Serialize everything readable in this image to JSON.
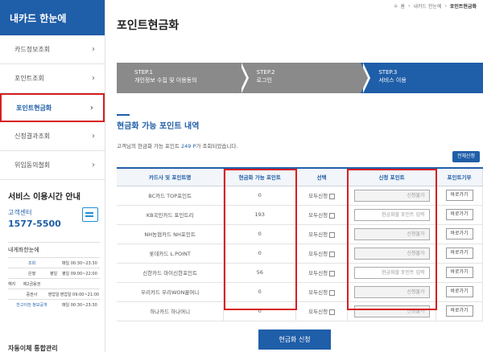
{
  "sidebar": {
    "title": "내카드 한눈에",
    "items": [
      {
        "label": "카드정보조회",
        "active": false
      },
      {
        "label": "포인트조회",
        "active": false
      },
      {
        "label": "포인트현금화",
        "active": true
      },
      {
        "label": "신청결과조회",
        "active": false
      },
      {
        "label": "위임동의철회",
        "active": false
      }
    ],
    "service": {
      "title": "서비스 이용시간 안내",
      "center_label": "고객센터",
      "phone": "1577-5500",
      "sub_title": "내게좌한눈에",
      "hours": [
        [
          "",
          "조회",
          "",
          "매일 00:30~23:30"
        ],
        [
          "",
          "은행",
          "평일",
          "평일 09:00~22:00"
        ],
        [
          "해지",
          "제2금융권",
          "",
          ""
        ],
        [
          "",
          "증권사",
          "영업일",
          "영업일 09:00~21:00"
        ],
        [
          "",
          "잔고이전 정보공개",
          "",
          "매일 00:30~23:30"
        ]
      ]
    },
    "footer": "자동이체 통합관리"
  },
  "breadcrumb": [
    "홈",
    "내카드 한눈에",
    "포인트현금화"
  ],
  "page_title": "포인트현금화",
  "steps": [
    {
      "num": "STEP.1",
      "label": "개인정보 수집 및 이용동의",
      "state": "done"
    },
    {
      "num": "STEP.2",
      "label": "로그인",
      "state": "done"
    },
    {
      "num": "STEP.3",
      "label": "서비스 이용",
      "state": "current"
    }
  ],
  "section_title": "현금화 가능 포인트 내역",
  "description": {
    "prefix": "고객님의 현금화 가능 포인트 ",
    "count": "249 P",
    "suffix": "가 조회되었습니다."
  },
  "apply_all_label": "전체신청",
  "table": {
    "headers": [
      "카드사 및 포인트명",
      "현금화 가능 포인트",
      "선택",
      "신청 포인트",
      "포인트기부"
    ],
    "rows": [
      {
        "name": "BC카드 TOP포인트",
        "points": "0",
        "select": "모두신청",
        "input": "신청불가",
        "input_disabled": true,
        "action": "바로가기"
      },
      {
        "name": "KB국민카드 포인트리",
        "points": "193",
        "select": "모두신청",
        "input": "현금화할 포인트 입력",
        "input_disabled": false,
        "action": "바로가기"
      },
      {
        "name": "NH농협카드 NH포인트",
        "points": "0",
        "select": "모두신청",
        "input": "신청불가",
        "input_disabled": true,
        "action": "바로가기"
      },
      {
        "name": "롯데카드 L.POINT",
        "points": "0",
        "select": "모두신청",
        "input": "신청불가",
        "input_disabled": true,
        "action": "바로가기"
      },
      {
        "name": "신한카드 마이신한포인트",
        "points": "56",
        "select": "모두신청",
        "input": "현금화할 포인트 입력",
        "input_disabled": false,
        "action": "바로가기"
      },
      {
        "name": "우리카드 우리WON꿀머니",
        "points": "0",
        "select": "모두신청",
        "input": "신청불가",
        "input_disabled": true,
        "action": "바로가기"
      },
      {
        "name": "하나카드 하나머니",
        "points": "0",
        "select": "모두신청",
        "input": "신청불가",
        "input_disabled": true,
        "action": "바로가기"
      }
    ]
  },
  "submit_label": "현금화 신청",
  "colors": {
    "primary": "#1f5ea8",
    "highlight": "#d81e1e"
  }
}
